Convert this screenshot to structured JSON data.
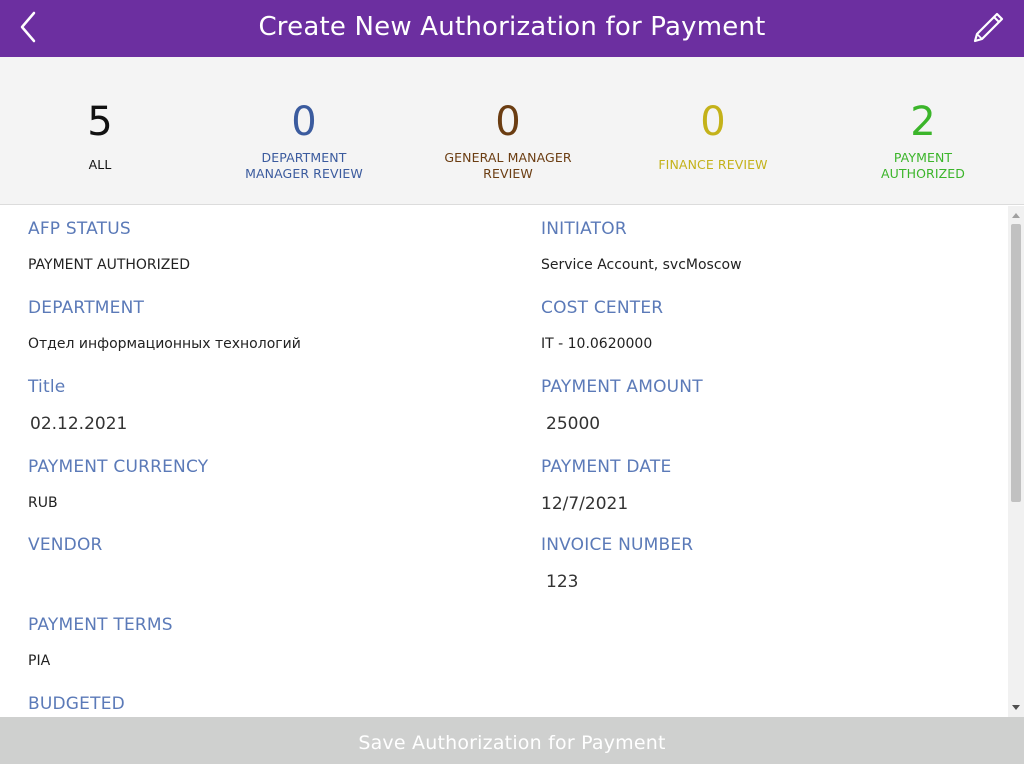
{
  "header": {
    "title": "Create New Authorization for Payment",
    "back_icon": "chevron-left-icon",
    "edit_icon": "pencil-icon",
    "background_color": "#6c2fa0"
  },
  "summary": [
    {
      "count": "5",
      "label": "ALL",
      "color": "#111111"
    },
    {
      "count": "0",
      "label": "DEPARTMENT\nMANAGER REVIEW",
      "color": "#3b5b9e"
    },
    {
      "count": "0",
      "label": "GENERAL MANAGER\nREVIEW",
      "color": "#6b3d12"
    },
    {
      "count": "0",
      "label": "FINANCE REVIEW",
      "color": "#c4b21a"
    },
    {
      "count": "2",
      "label": "PAYMENT\nAUTHORIZED",
      "color": "#3bb52a"
    }
  ],
  "fields": {
    "afp_status": {
      "label": "AFP STATUS",
      "value": "PAYMENT AUTHORIZED"
    },
    "initiator": {
      "label": "INITIATOR",
      "value": "Service Account, svcMoscow"
    },
    "department": {
      "label": "DEPARTMENT",
      "value": "Отдел информационных технологий"
    },
    "cost_center": {
      "label": "COST CENTER",
      "value": "IT - 10.0620000"
    },
    "title": {
      "label": "Title",
      "value": "02.12.2021"
    },
    "payment_amount": {
      "label": "PAYMENT AMOUNT",
      "value": "25000"
    },
    "payment_currency": {
      "label": "PAYMENT CURRENCY",
      "value": "RUB"
    },
    "payment_date": {
      "label": "PAYMENT DATE",
      "value": "12/7/2021"
    },
    "vendor": {
      "label": "VENDOR",
      "value": ""
    },
    "invoice_number": {
      "label": "INVOICE NUMBER",
      "value": "123"
    },
    "payment_terms": {
      "label": "PAYMENT TERMS",
      "value": "PIA"
    },
    "budgeted": {
      "label": "BUDGETED"
    }
  },
  "footer": {
    "save_label": "Save Authorization for Payment"
  }
}
